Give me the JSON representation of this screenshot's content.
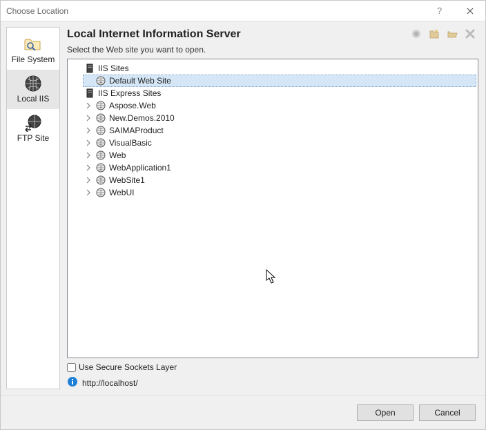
{
  "window": {
    "title": "Choose Location"
  },
  "sidebar": {
    "items": [
      {
        "label": "File System",
        "icon": "folder-search"
      },
      {
        "label": "Local IIS",
        "icon": "globe-grid"
      },
      {
        "label": "FTP Site",
        "icon": "globe-arrows"
      }
    ]
  },
  "main": {
    "title": "Local Internet Information Server",
    "subtitle": "Select the Web site you want to open.",
    "toolbar": {
      "new_app": "new-app-icon",
      "new_vdir": "new-vdir-icon",
      "open": "open-folder-icon",
      "delete": "delete-icon"
    }
  },
  "tree": {
    "root1": {
      "label": "IIS Sites"
    },
    "root1_children": [
      {
        "label": "Default Web Site",
        "selected": true
      }
    ],
    "root2": {
      "label": "IIS Express Sites"
    },
    "root2_children": [
      {
        "label": "Aspose.Web"
      },
      {
        "label": "New.Demos.2010"
      },
      {
        "label": "SAIMAProduct"
      },
      {
        "label": "VisualBasic"
      },
      {
        "label": "Web"
      },
      {
        "label": "WebApplication1"
      },
      {
        "label": "WebSite1"
      },
      {
        "label": "WebUI"
      }
    ]
  },
  "options": {
    "ssl_label": "Use Secure Sockets Layer",
    "ssl_checked": false,
    "url": "http://localhost/"
  },
  "buttons": {
    "open": "Open",
    "cancel": "Cancel"
  }
}
